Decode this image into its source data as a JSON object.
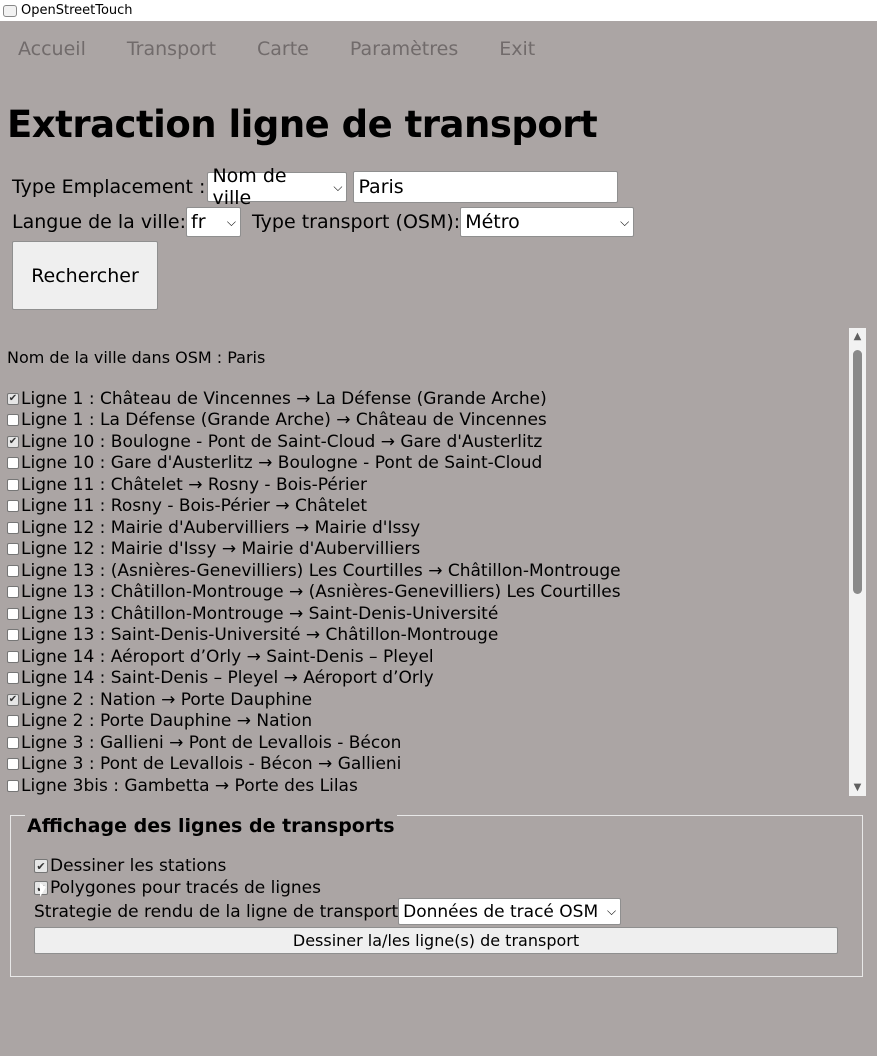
{
  "window": {
    "title": "OpenStreetTouch"
  },
  "menu": [
    "Accueil",
    "Transport",
    "Carte",
    "Paramètres",
    "Exit"
  ],
  "page": {
    "title": "Extraction ligne de transport"
  },
  "form": {
    "location_type_label": "Type Emplacement :",
    "location_type_value": "Nom de ville",
    "city_value": "Paris",
    "language_label": "Langue de la ville:",
    "language_value": "fr",
    "transport_type_label": "Type transport (OSM):",
    "transport_type_value": "Métro",
    "search_button": "Rechercher"
  },
  "results": {
    "city_line": "Nom de la ville dans OSM : Paris",
    "lines": [
      {
        "label": "Ligne 1 : Château de Vincennes → La Défense (Grande Arche)",
        "checked": true
      },
      {
        "label": "Ligne 1 : La Défense (Grande Arche) → Château de Vincennes",
        "checked": false
      },
      {
        "label": "Ligne 10 : Boulogne - Pont de Saint-Cloud → Gare d'Austerlitz",
        "checked": true
      },
      {
        "label": "Ligne 10 : Gare d'Austerlitz → Boulogne - Pont de Saint-Cloud",
        "checked": false
      },
      {
        "label": "Ligne 11 : Châtelet → Rosny - Bois-Périer",
        "checked": false
      },
      {
        "label": "Ligne 11 : Rosny - Bois-Périer → Châtelet",
        "checked": false
      },
      {
        "label": "Ligne 12 : Mairie d'Aubervilliers → Mairie d'Issy",
        "checked": false
      },
      {
        "label": "Ligne 12 : Mairie d'Issy → Mairie d'Aubervilliers",
        "checked": false
      },
      {
        "label": "Ligne 13 : (Asnières-Genevilliers) Les Courtilles → Châtillon-Montrouge",
        "checked": false
      },
      {
        "label": "Ligne 13 : Châtillon-Montrouge → (Asnières-Genevilliers) Les Courtilles",
        "checked": false
      },
      {
        "label": "Ligne 13 : Châtillon-Montrouge → Saint-Denis-Université",
        "checked": false
      },
      {
        "label": "Ligne 13 : Saint-Denis-Université → Châtillon-Montrouge",
        "checked": false
      },
      {
        "label": "Ligne 14 : Aéroport d’Orly → Saint-Denis – Pleyel",
        "checked": false
      },
      {
        "label": "Ligne 14 : Saint-Denis – Pleyel → Aéroport d’Orly",
        "checked": false
      },
      {
        "label": "Ligne 2 : Nation → Porte Dauphine",
        "checked": true
      },
      {
        "label": "Ligne 2 : Porte Dauphine → Nation",
        "checked": false
      },
      {
        "label": "Ligne 3 : Gallieni → Pont de Levallois - Bécon",
        "checked": false
      },
      {
        "label": "Ligne 3 : Pont de Levallois - Bécon → Gallieni",
        "checked": false
      },
      {
        "label": "Ligne 3bis : Gambetta → Porte des Lilas",
        "checked": false
      }
    ]
  },
  "display": {
    "legend": "Affichage des lignes de transports",
    "draw_stations": {
      "label": "Dessiner les stations",
      "checked": true
    },
    "polygons": {
      "label": "Polygones pour tracés de lignes",
      "checked": true
    },
    "strategy_label": "Strategie de rendu de la ligne de transport",
    "strategy_value": "Données de tracé OSM",
    "draw_button": "Dessiner la/les ligne(s) de transport"
  }
}
